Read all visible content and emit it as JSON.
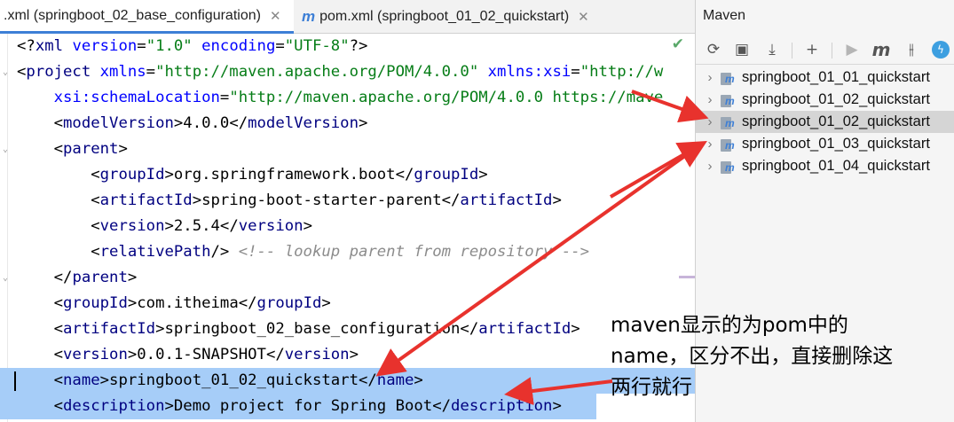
{
  "tabs": [
    {
      "label": ".xml (springboot_02_base_configuration)",
      "close": "✕",
      "active": true
    },
    {
      "label": "pom.xml (springboot_01_02_quickstart)",
      "close": "✕",
      "active": false,
      "icon": "m"
    }
  ],
  "editor": {
    "lines": [
      [
        [
          "p",
          "<?"
        ],
        [
          "t",
          "xml "
        ],
        [
          "a",
          "version"
        ],
        [
          "p",
          "="
        ],
        [
          "s",
          "\"1.0\" "
        ],
        [
          "a",
          "encoding"
        ],
        [
          "p",
          "="
        ],
        [
          "s",
          "\"UTF-8\""
        ],
        [
          "p",
          "?>"
        ]
      ],
      [
        [
          "p",
          "<"
        ],
        [
          "t",
          "project "
        ],
        [
          "a",
          "xmlns"
        ],
        [
          "p",
          "="
        ],
        [
          "s",
          "\"http://maven.apache.org/POM/4.0.0\" "
        ],
        [
          "a",
          "xmlns:xsi"
        ],
        [
          "p",
          "="
        ],
        [
          "s",
          "\"http://w"
        ]
      ],
      [
        [
          "p",
          "    "
        ],
        [
          "a",
          "xsi:schemaLocation"
        ],
        [
          "p",
          "="
        ],
        [
          "s",
          "\"http://maven.apache.org/POM/4.0.0 https://mave"
        ]
      ],
      [
        [
          "p",
          "    <"
        ],
        [
          "t",
          "modelVersion"
        ],
        [
          "p",
          ">4.0.0</"
        ],
        [
          "t",
          "modelVersion"
        ],
        [
          "p",
          ">"
        ]
      ],
      [
        [
          "p",
          "    <"
        ],
        [
          "t",
          "parent"
        ],
        [
          "p",
          ">"
        ]
      ],
      [
        [
          "p",
          "        <"
        ],
        [
          "t",
          "groupId"
        ],
        [
          "p",
          ">org.springframework.boot</"
        ],
        [
          "t",
          "groupId"
        ],
        [
          "p",
          ">"
        ]
      ],
      [
        [
          "p",
          "        <"
        ],
        [
          "t",
          "artifactId"
        ],
        [
          "p",
          ">spring-boot-starter-parent</"
        ],
        [
          "t",
          "artifactId"
        ],
        [
          "p",
          ">"
        ]
      ],
      [
        [
          "p",
          "        <"
        ],
        [
          "t",
          "version"
        ],
        [
          "p",
          ">2.5.4</"
        ],
        [
          "t",
          "version"
        ],
        [
          "p",
          ">"
        ]
      ],
      [
        [
          "p",
          "        <"
        ],
        [
          "t",
          "relativePath"
        ],
        [
          "p",
          "/> "
        ],
        [
          "c",
          "<!-- lookup parent from repository -->"
        ]
      ],
      [
        [
          "p",
          "    </"
        ],
        [
          "t",
          "parent"
        ],
        [
          "p",
          ">"
        ]
      ],
      [
        [
          "p",
          "    <"
        ],
        [
          "t",
          "groupId"
        ],
        [
          "p",
          ">com.itheima</"
        ],
        [
          "t",
          "groupId"
        ],
        [
          "p",
          ">"
        ]
      ],
      [
        [
          "p",
          "    <"
        ],
        [
          "t",
          "artifactId"
        ],
        [
          "p",
          ">springboot_02_base_configuration</"
        ],
        [
          "t",
          "artifactId"
        ],
        [
          "p",
          ">"
        ]
      ],
      [
        [
          "p",
          "    <"
        ],
        [
          "t",
          "version"
        ],
        [
          "p",
          ">0.0.1-SNAPSHOT</"
        ],
        [
          "t",
          "version"
        ],
        [
          "p",
          ">"
        ]
      ],
      [
        [
          "p",
          "    <"
        ],
        [
          "t",
          "name"
        ],
        [
          "p",
          ">springboot_01_02_quickstart</"
        ],
        [
          "t",
          "name"
        ],
        [
          "p",
          ">"
        ]
      ],
      [
        [
          "p",
          "    <"
        ],
        [
          "t",
          "description"
        ],
        [
          "p",
          ">Demo project for Spring Boot</"
        ],
        [
          "t",
          "description"
        ],
        [
          "p",
          ">"
        ]
      ]
    ],
    "selected_lines": [
      13,
      14
    ],
    "status_icon": "check-icon"
  },
  "maven": {
    "title": "Maven",
    "toolbar": [
      "refresh-icon",
      "add-folder-icon",
      "download-icon",
      "plus-icon",
      "run-icon",
      "maven-goal-icon",
      "toggle-offline-icon",
      "lightning-icon"
    ],
    "projects": [
      {
        "label": "springboot_01_01_quickstart",
        "selected": false
      },
      {
        "label": "springboot_01_02_quickstart",
        "selected": false
      },
      {
        "label": "springboot_01_02_quickstart",
        "selected": true
      },
      {
        "label": "springboot_01_03_quickstart",
        "selected": false
      },
      {
        "label": "springboot_01_04_quickstart",
        "selected": false
      }
    ]
  },
  "annotation": {
    "lines": [
      "maven显示的为pom中的",
      "name，区分不出，直接删除这",
      "两行就行"
    ],
    "arrow_color": "#e8322d"
  }
}
